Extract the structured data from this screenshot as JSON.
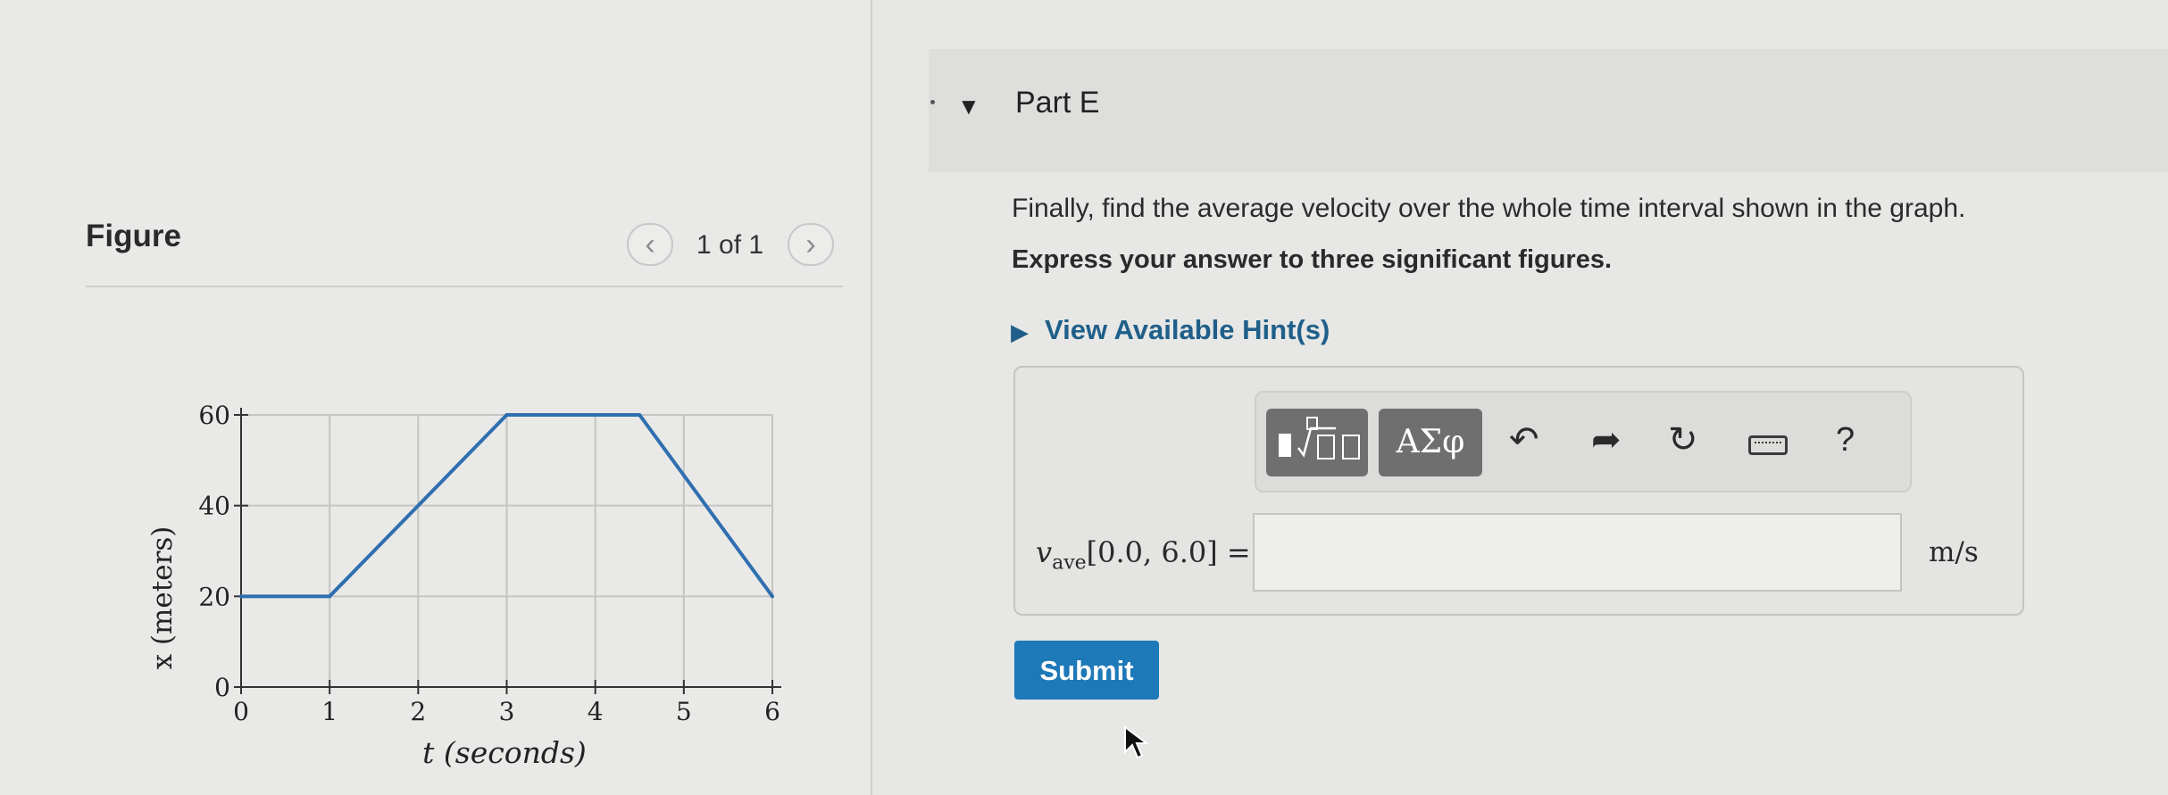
{
  "figure": {
    "title": "Figure",
    "counter": "1 of 1",
    "prev_icon": "chevron-left-icon",
    "next_icon": "chevron-right-icon"
  },
  "part": {
    "title": "Part E",
    "question": "Finally, find the average velocity over the whole time interval shown in the graph.",
    "instruction": "Express your answer to three significant figures.",
    "hint_link": "View Available Hint(s)"
  },
  "toolbar": {
    "template_icon": "fraction-sqrt-template-icon",
    "greek_label": "ΑΣφ",
    "undo_icon": "undo-icon",
    "redo_icon": "redo-icon",
    "reset_icon": "reset-icon",
    "keyboard_icon": "keyboard-icon",
    "help_label": "?"
  },
  "answer": {
    "variable": "v",
    "subscript": "ave",
    "interval": "[0.0, 6.0]",
    "equals": "=",
    "value": "",
    "units": "m/s"
  },
  "submit_label": "Submit",
  "colors": {
    "accent": "#1d79b8",
    "link": "#1f5f8a",
    "line": "#2f6fb0"
  },
  "chart_data": {
    "type": "line",
    "xlabel": "t (seconds)",
    "ylabel": "x (meters)",
    "xlim": [
      0,
      6
    ],
    "ylim": [
      0,
      60
    ],
    "xticks": [
      "0",
      "1",
      "2",
      "3",
      "4",
      "5",
      "6"
    ],
    "yticks": [
      "0",
      "20",
      "40",
      "60"
    ],
    "grid": true,
    "x": [
      0,
      1,
      3,
      4.5,
      6
    ],
    "series": [
      {
        "values": [
          20,
          20,
          60,
          60,
          20
        ]
      }
    ]
  }
}
